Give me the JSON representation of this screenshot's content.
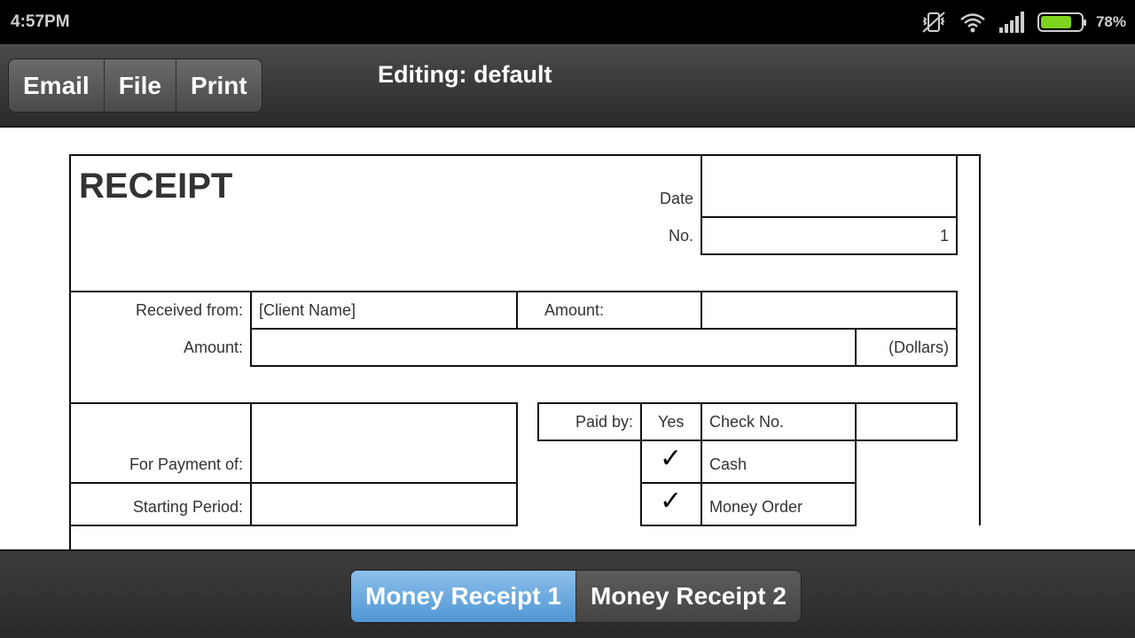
{
  "status": {
    "time": "4:57PM",
    "battery_pct": "78%",
    "battery_level": 0.78
  },
  "toolbar": {
    "buttons": [
      "Email",
      "File",
      "Print"
    ],
    "title": "Editing: default"
  },
  "receipt": {
    "heading": "RECEIPT",
    "date_label": "Date",
    "date_value": "",
    "no_label": "No.",
    "no_value": "1",
    "received_from_label": "Received from:",
    "received_from_value": "[Client Name]",
    "amount_label_right": "Amount:",
    "amount_value_right": "",
    "amount_label": "Amount:",
    "amount_words_value": "",
    "dollars_label": "(Dollars)",
    "for_payment_label": "For Payment of:",
    "for_payment_value": "",
    "starting_period_label": "Starting Period:",
    "starting_period_value": "",
    "paid_by_label": "Paid by:",
    "yes_label": "Yes",
    "check_no_label": "Check No.",
    "check_no_value": "",
    "cash_label": "Cash",
    "money_order_label": "Money Order",
    "checkmark": "✓"
  },
  "bottom_tabs": [
    "Money Receipt 1",
    "Money Receipt 2"
  ]
}
